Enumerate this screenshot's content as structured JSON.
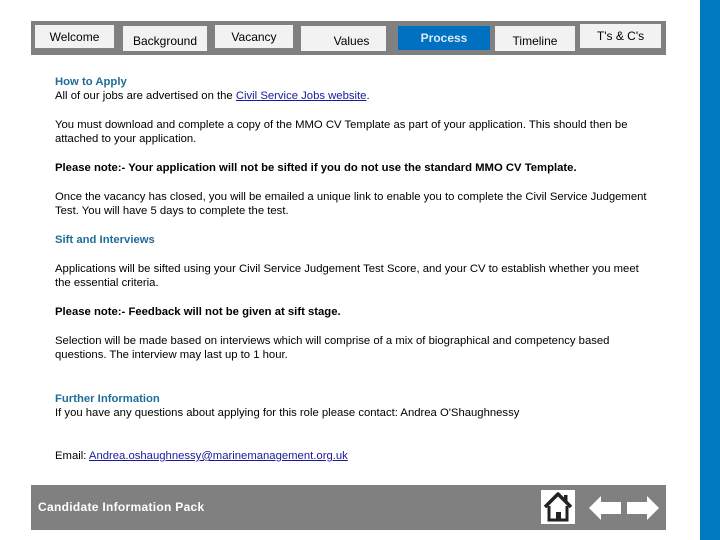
{
  "nav": {
    "tabs": [
      {
        "label": "Welcome",
        "active": false
      },
      {
        "label": "Background",
        "active": false
      },
      {
        "label": "Vacancy",
        "active": false
      },
      {
        "label": "Values",
        "active": false
      },
      {
        "label": "Process",
        "active": true
      },
      {
        "label": "Timeline",
        "active": false
      },
      {
        "label": "T's & C's",
        "active": false
      }
    ]
  },
  "content": {
    "how_to_apply": {
      "heading": "How to Apply",
      "text_before_link": "All of our jobs are advertised on the ",
      "link_text": "Civil Service Jobs website",
      "text_after_link": "."
    },
    "download_text": "You must download and complete a copy of the MMO CV Template as part of your application. This should then be attached to your application.",
    "note_1": "Please note:- Your application will not be sifted if you do not use the standard MMO CV Template.",
    "judgement_text": "Once the vacancy has closed, you will be emailed a unique link to enable you to complete the Civil Service Judgement Test. You will have 5 days to complete the test.",
    "sift_heading": "Sift and Interviews",
    "sift_text": "Applications will be sifted using your Civil Service Judgement Test Score, and your CV to establish whether you meet the essential criteria.",
    "note_2": "Please note:- Feedback will not be given at sift stage.",
    "selection_text": "Selection will be made based on interviews which will comprise of a mix of biographical and competency based questions. The interview may last up to 1 hour.",
    "further_heading": "Further Information",
    "further_text": "If you have any questions about applying for this role please contact: Andrea O'Shaughnessy",
    "email_label": "Email: ",
    "email_link": "Andrea.oshaughnessy@marinemanagement.org.uk"
  },
  "footer": {
    "title": "Candidate Information Pack",
    "icons": {
      "home": "home-icon",
      "back": "arrow-left-icon",
      "forward": "arrow-right-icon"
    }
  },
  "colors": {
    "accent_blue": "#0070c0",
    "side_bar": "#0079bf",
    "nav_grey": "#808080",
    "heading_blue": "#1f6e99"
  }
}
